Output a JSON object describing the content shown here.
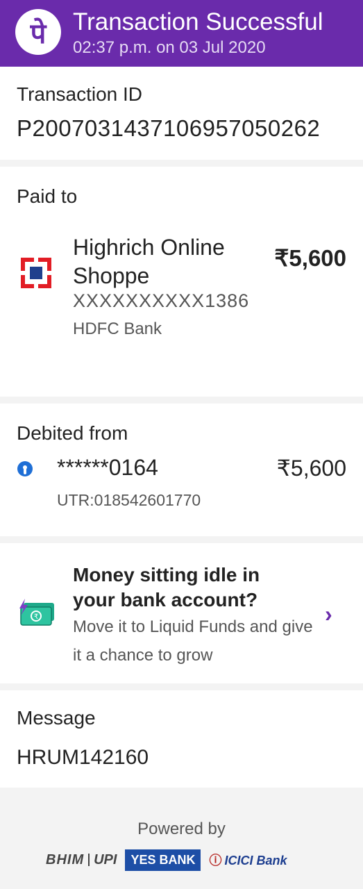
{
  "header": {
    "logo_glyph": "पे",
    "title": "Transaction Successful",
    "timestamp": "02:37 p.m. on 03 Jul 2020",
    "background_color": "#6a2bab"
  },
  "transaction": {
    "label": "Transaction ID",
    "id": "P2007031437106957050262"
  },
  "paid_to": {
    "label": "Paid to",
    "name": "Highrich Online Shoppe",
    "account": "XXXXXXXXXX1386",
    "bank": "HDFC Bank",
    "amount": "₹5,600",
    "bank_icon": "hdfc-bank-logo"
  },
  "debited_from": {
    "label": "Debited from",
    "account": "******0164",
    "amount": "₹5,600",
    "utr": "UTR:018542601770",
    "bank_icon": "sbi-logo"
  },
  "promo": {
    "title": "Money sitting idle in your bank account?",
    "subtitle": "Move it to Liquid Funds and give it a chance to grow",
    "icon": "money-notes-icon",
    "chevron": "›"
  },
  "message": {
    "label": "Message",
    "value": "HRUM142160"
  },
  "footer": {
    "powered_by": "Powered by",
    "bhim": "BHIM",
    "upi": "UPI",
    "yes_bank": "YES BANK",
    "icici": "ICICI Bank"
  }
}
